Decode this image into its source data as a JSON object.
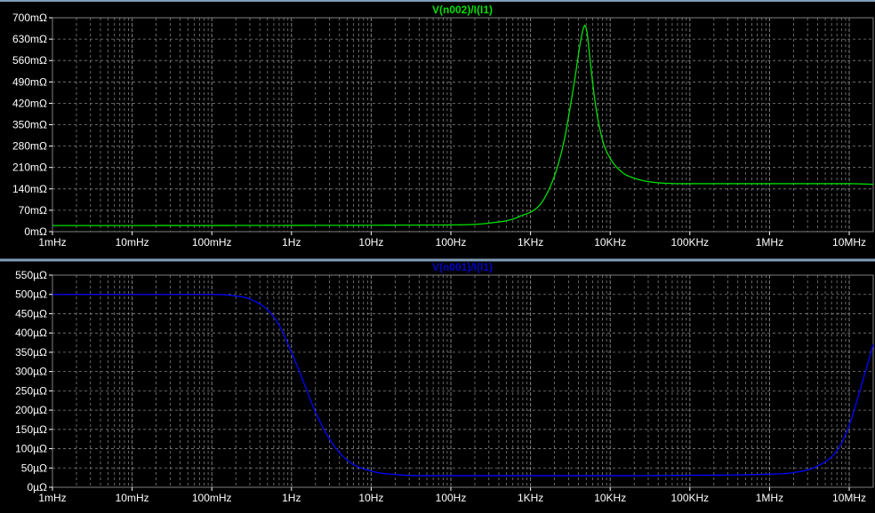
{
  "colors": {
    "background": "#000000",
    "axis_text": "#ffffff",
    "grid": "#808080",
    "frame": "#000000",
    "window_border": "#7f9db9",
    "top_trace": "#00e000",
    "bottom_trace": "#0000ff",
    "top_title": "#00e000",
    "bottom_title": "#0000c8"
  },
  "chart_data": [
    {
      "type": "line",
      "title": "V(n002)/I(I1)",
      "x_scale": "log",
      "xlim": [
        "1mHz",
        "20MHz"
      ],
      "x_ticks": [
        "1mHz",
        "10mHz",
        "100mHz",
        "1Hz",
        "10Hz",
        "100Hz",
        "1KHz",
        "10KHz",
        "100KHz",
        "1MHz",
        "10MHz"
      ],
      "y_unit": "mΩ",
      "ylim": [
        0,
        700
      ],
      "y_ticks": [
        "0mΩ",
        "70mΩ",
        "140mΩ",
        "210mΩ",
        "280mΩ",
        "350mΩ",
        "420mΩ",
        "490mΩ",
        "560mΩ",
        "630mΩ",
        "700mΩ"
      ],
      "grid": true,
      "series": [
        {
          "name": "V(n002)/I(I1)",
          "x": [
            "1mHz",
            "100Hz",
            "300Hz",
            "700Hz",
            "1.5KHz",
            "2.5KHz",
            "3.5KHz",
            "4.3KHz",
            "4.8KHz",
            "5.1KHz",
            "5.6KHz",
            "6.5KHz",
            "8KHz",
            "10KHz",
            "14KHz",
            "20KHz",
            "40KHz",
            "100KHz",
            "1MHz",
            "10MHz",
            "20MHz"
          ],
          "values": [
            20,
            22,
            28,
            48,
            110,
            270,
            480,
            630,
            675,
            655,
            560,
            420,
            300,
            240,
            195,
            175,
            160,
            157,
            157,
            157,
            155
          ]
        }
      ]
    },
    {
      "type": "line",
      "title": "V(n001)/I(I1)",
      "x_scale": "log",
      "xlim": [
        "1mHz",
        "20MHz"
      ],
      "x_ticks": [
        "1mHz",
        "10mHz",
        "100mHz",
        "1Hz",
        "10Hz",
        "100Hz",
        "1KHz",
        "10KHz",
        "100KHz",
        "1MHz",
        "10MHz"
      ],
      "y_unit": "µΩ",
      "ylim": [
        0,
        550
      ],
      "y_ticks": [
        "0µΩ",
        "50µΩ",
        "100µΩ",
        "150µΩ",
        "200µΩ",
        "250µΩ",
        "300µΩ",
        "350µΩ",
        "400µΩ",
        "450µΩ",
        "500µΩ",
        "550µΩ"
      ],
      "grid": true,
      "series": [
        {
          "name": "V(n001)/I(I1)",
          "x": [
            "1mHz",
            "100mHz",
            "200mHz",
            "300mHz",
            "500mHz",
            "700mHz",
            "1Hz",
            "1.5Hz",
            "2Hz",
            "3Hz",
            "5Hz",
            "10Hz",
            "20Hz",
            "50Hz",
            "100Hz",
            "1KHz",
            "10KHz",
            "100KHz",
            "1MHz",
            "2MHz",
            "4MHz",
            "7MHz",
            "10MHz",
            "14MHz",
            "20MHz"
          ],
          "values": [
            500,
            500,
            496,
            488,
            460,
            420,
            350,
            260,
            195,
            125,
            70,
            42,
            33,
            30,
            30,
            30,
            30,
            31,
            34,
            38,
            55,
            95,
            160,
            260,
            370
          ]
        }
      ]
    }
  ]
}
